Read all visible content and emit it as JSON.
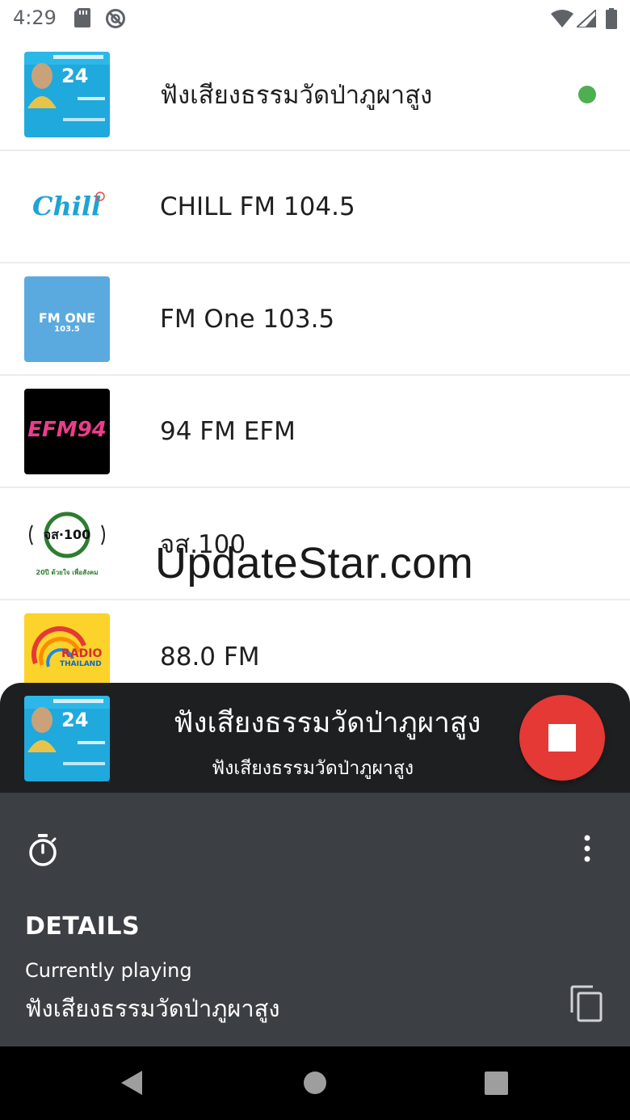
{
  "status_bar": {
    "time": "4:29",
    "icons": [
      "sd-card-icon",
      "blocked-circle-icon",
      "wifi-icon",
      "signal-icon",
      "battery-icon"
    ]
  },
  "stations": [
    {
      "name": "ฟังเสียงธรรมวัดป่าภูผาสูง",
      "logo": "wat-phuphasung-logo",
      "logo_text": "24",
      "active": true
    },
    {
      "name": "CHILL FM 104.5",
      "logo": "chill-logo",
      "logo_text": "Chill",
      "active": false
    },
    {
      "name": "FM One 103.5",
      "logo": "fm-one-logo",
      "logo_text": "FM ONE",
      "logo_subtext": "103.5",
      "active": false
    },
    {
      "name": "94 FM EFM",
      "logo": "efm94-logo",
      "logo_text": "EFM94",
      "active": false
    },
    {
      "name": "จส.100",
      "logo": "js100-logo",
      "logo_text": "จส·100",
      "logo_subtext": "20ปี ด้วยใจ เพื่อสังคม",
      "active": false
    },
    {
      "name": "88.0 FM",
      "logo": "radio-thailand-logo",
      "logo_text": "RADIO",
      "logo_subtext": "THAILAND",
      "active": false
    }
  ],
  "watermark": "UpdateStar.com",
  "now_playing": {
    "title": "ฟังเสียงธรรมวัดป่าภูผาสูง",
    "subtitle": "ฟังเสียงธรรมวัดป่าภูผาสูง",
    "logo_text": "24"
  },
  "details": {
    "heading": "DETAILS",
    "currently_playing_label": "Currently playing",
    "currently_playing_value": "ฟังเสียงธรรมวัดป่าภูผาสูง"
  },
  "colors": {
    "active_dot": "#4caf50",
    "stop_button": "#e53935",
    "now_playing_bg": "#1e1f21",
    "details_bg": "#3c3f43"
  }
}
